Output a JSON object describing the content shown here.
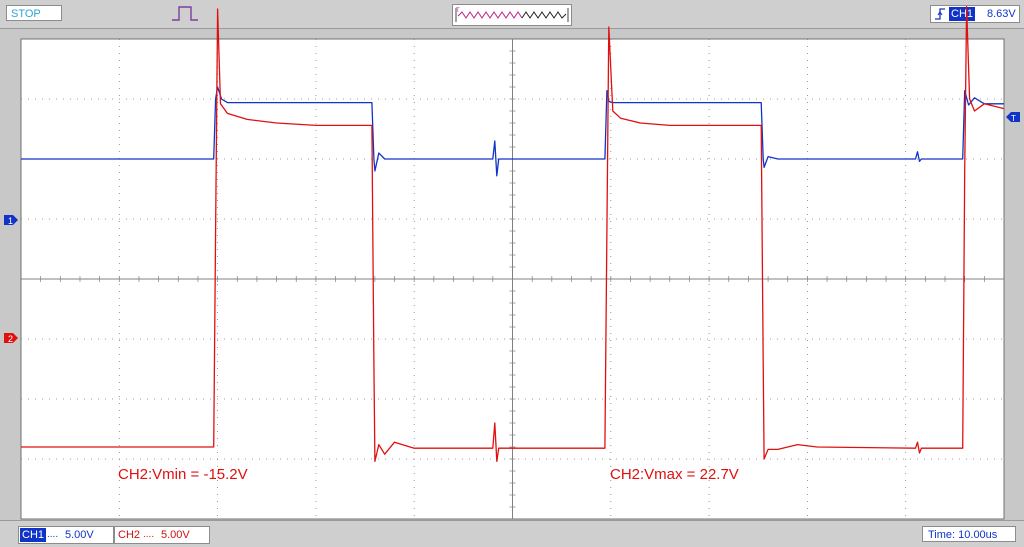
{
  "header": {
    "status": "STOP",
    "trigger_channel": "CH1",
    "trigger_level": "8.63V",
    "trigger_edge_icon": "rising-edge-icon",
    "pulse_icon": "pulse-icon",
    "memory_icon": "memory-waveform-icon"
  },
  "markers": {
    "ch1": "1",
    "ch2": "2",
    "trigger": "T"
  },
  "footer": {
    "ch1_label": "CH1",
    "ch1_coupling": "....",
    "ch1_scale": "5.00V",
    "ch2_label": "CH2",
    "ch2_coupling": "....",
    "ch2_scale": "5.00V",
    "time": "Time: 10.00us"
  },
  "colors": {
    "ch1": "#1034c8",
    "ch2": "#e01010",
    "grid": "#808080",
    "background": "#ffffff"
  },
  "chart_data": {
    "type": "line",
    "title": "",
    "xlabel": "",
    "ylabel": "",
    "grid": true,
    "x_unit": "us",
    "y_unit": "V",
    "xlim": [
      0,
      100
    ],
    "ylim": [
      -20,
      20
    ],
    "annotations": [
      "CH2:Vmin = -15.2V",
      "CH2:Vmax = 22.7V"
    ],
    "series": [
      {
        "name": "CH1",
        "color": "#1034c8",
        "x": [
          0,
          19.6,
          19.8,
          20.0,
          20.4,
          21.0,
          35.7,
          35.9,
          36.0,
          36.4,
          37.0,
          48.0,
          48.2,
          48.4,
          48.6,
          49.0,
          59.4,
          59.6,
          59.8,
          60.2,
          61.0,
          75.3,
          75.5,
          75.6,
          76.0,
          77.0,
          91.0,
          91.2,
          91.4,
          91.6,
          95.8,
          96.0,
          96.4,
          97.0,
          98.0,
          100
        ],
        "y": [
          10.0,
          10.0,
          15.0,
          16.0,
          15.0,
          14.7,
          14.7,
          10.0,
          9.0,
          10.5,
          10.0,
          10.0,
          11.5,
          8.6,
          10.0,
          10.0,
          10.0,
          15.7,
          14.8,
          14.7,
          14.7,
          14.7,
          10.0,
          9.3,
          10.2,
          10.0,
          10.0,
          10.6,
          9.8,
          10.0,
          10.0,
          15.7,
          14.5,
          15.1,
          14.6,
          14.6
        ]
      },
      {
        "name": "CH2",
        "color": "#e01010",
        "x": [
          0,
          19.6,
          19.8,
          20.0,
          20.3,
          21.0,
          23.0,
          26.0,
          30.0,
          35.7,
          35.9,
          36.0,
          36.4,
          37.0,
          38.0,
          40.0,
          48.0,
          48.2,
          48.4,
          48.6,
          49.0,
          59.4,
          59.6,
          59.8,
          60.2,
          61.0,
          63.0,
          66.0,
          70.0,
          75.3,
          75.5,
          75.6,
          76.0,
          77.0,
          79.0,
          81.0,
          91.0,
          91.2,
          91.4,
          91.6,
          95.8,
          96.0,
          96.2,
          96.5,
          97.0,
          98.0,
          100
        ],
        "y": [
          -14.0,
          -14.0,
          4.0,
          22.5,
          14.6,
          13.8,
          13.3,
          13.0,
          12.8,
          12.8,
          -7.0,
          -15.2,
          -13.8,
          -14.6,
          -13.6,
          -14.1,
          -14.1,
          -12.0,
          -15.2,
          -14.1,
          -14.1,
          -14.1,
          4.0,
          21.0,
          14.0,
          13.4,
          13.0,
          12.8,
          12.8,
          12.8,
          -7.0,
          -15.0,
          -14.2,
          -14.2,
          -13.8,
          -14.0,
          -14.1,
          -13.6,
          -14.5,
          -14.1,
          -14.1,
          9.0,
          22.7,
          15.0,
          14.0,
          14.6,
          14.2
        ]
      }
    ]
  }
}
